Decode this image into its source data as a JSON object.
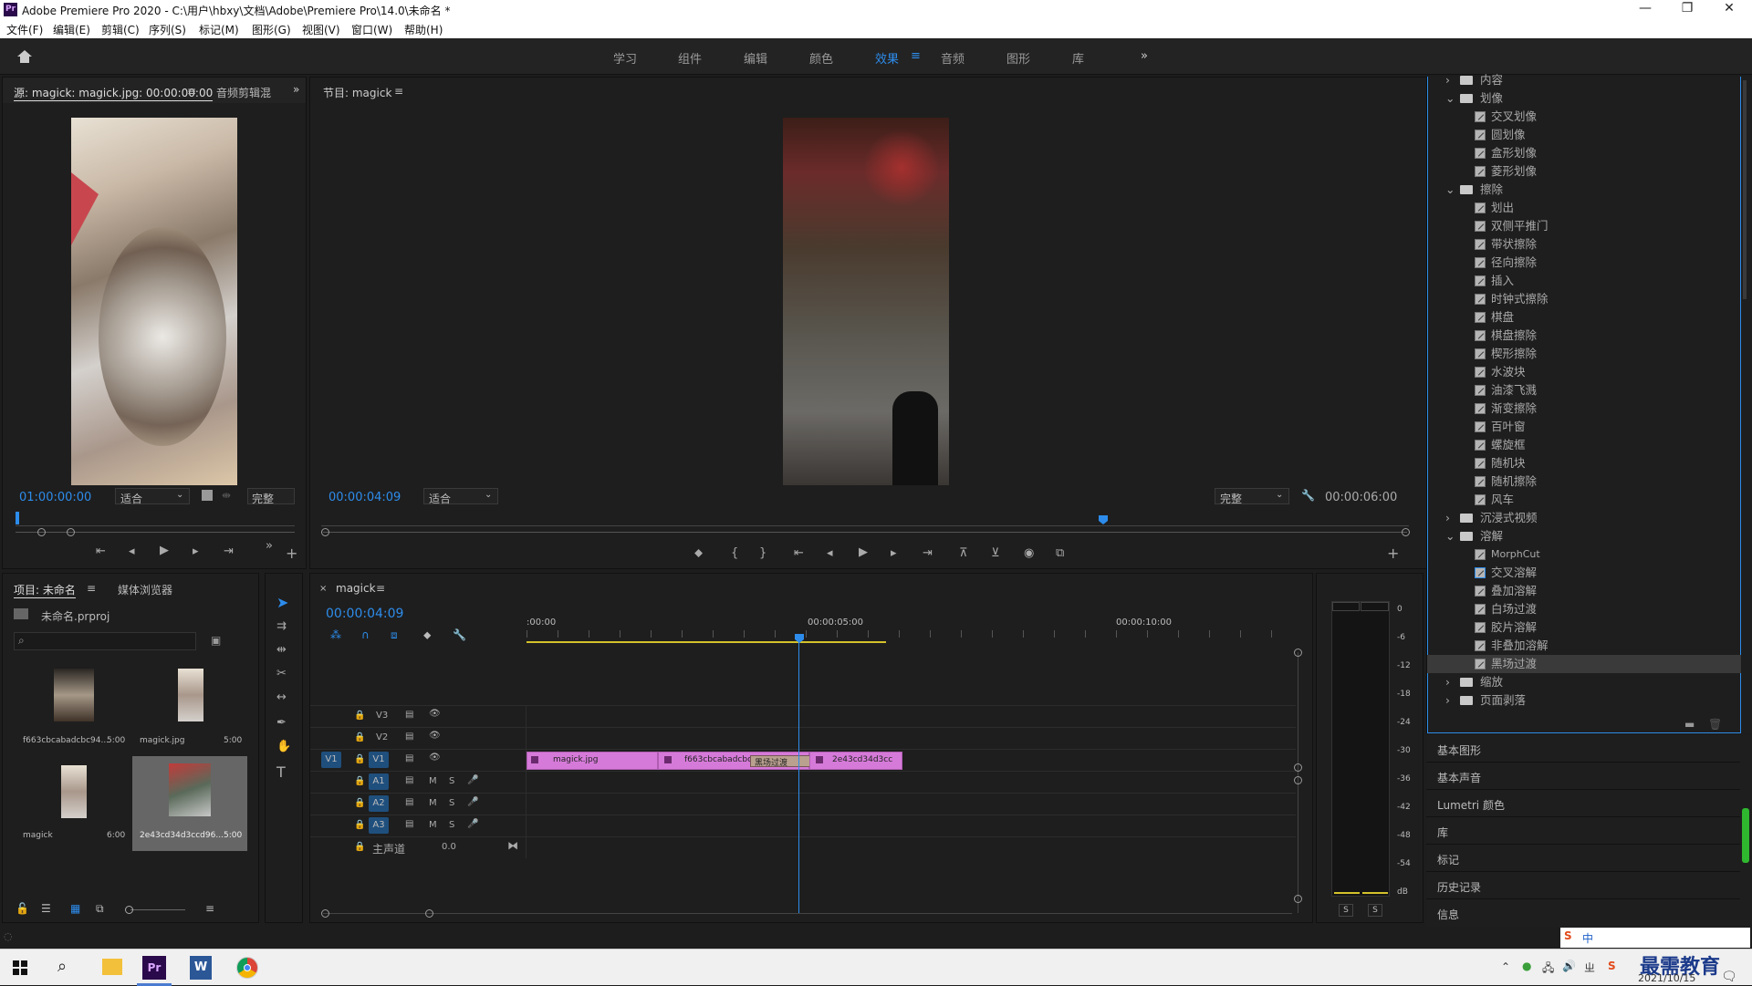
{
  "window": {
    "title": "Adobe Premiere Pro 2020 - C:\\用户\\hbxy\\文档\\Adobe\\Premiere Pro\\14.0\\未命名 *",
    "minimize": "—",
    "maximize": "❐",
    "close": "✕"
  },
  "menu": [
    "文件(F)",
    "编辑(E)",
    "剪辑(C)",
    "序列(S)",
    "标记(M)",
    "图形(G)",
    "视图(V)",
    "窗口(W)",
    "帮助(H)"
  ],
  "workspaces": [
    "学习",
    "组件",
    "编辑",
    "颜色",
    "效果",
    "音频",
    "图形",
    "库"
  ],
  "active_workspace": "效果",
  "source": {
    "tab": "源: magick: magick.jpg: 00:00:00:00",
    "tab2": "音频剪辑混",
    "timecode": "01:00:00:00",
    "fit": "适合",
    "quality": "完整"
  },
  "program": {
    "tab": "节目: magick",
    "timecode": "00:00:04:09",
    "fit": "适合",
    "quality": "完整",
    "duration": "00:00:06:00"
  },
  "project": {
    "tab": "项目: 未命名",
    "tab2": "媒体浏览器",
    "file": "未命名.prproj",
    "items": [
      {
        "name": "f663cbcabadcbc94...",
        "dur": "5:00"
      },
      {
        "name": "magick.jpg",
        "dur": "5:00"
      },
      {
        "name": "magick",
        "dur": "6:00"
      },
      {
        "name": "2e43cd34d3ccd96...",
        "dur": "5:00"
      }
    ]
  },
  "timeline": {
    "tab": "magick",
    "timecode": "00:00:04:09",
    "ruler": [
      ":00:00",
      "00:00:05:00",
      "00:00:10:00"
    ],
    "tracks": [
      "V3",
      "V2",
      "V1",
      "A1",
      "A2",
      "A3"
    ],
    "src_v1": "V1",
    "master": "主声道",
    "master_val": "0.0",
    "clips": [
      {
        "name": "magick.jpg"
      },
      {
        "name": "f663cbcabadcbc9"
      },
      {
        "name": "2e43cd34d3cc"
      }
    ],
    "transition": "黑场过渡",
    "m": "M",
    "s": "S"
  },
  "meter": {
    "scale": [
      "0",
      "-6",
      "-12",
      "-18",
      "-24",
      "-30",
      "-36",
      "-42",
      "-48",
      "-54",
      "dB"
    ],
    "s1": "S",
    "s2": "S"
  },
  "effects_tree": [
    {
      "type": "folder",
      "label": "内容",
      "open": false,
      "level": 0
    },
    {
      "type": "folder",
      "label": "划像",
      "open": true,
      "level": 0
    },
    {
      "type": "item",
      "label": "交叉划像"
    },
    {
      "type": "item",
      "label": "圆划像"
    },
    {
      "type": "item",
      "label": "盒形划像"
    },
    {
      "type": "item",
      "label": "菱形划像"
    },
    {
      "type": "folder",
      "label": "擦除",
      "open": true,
      "level": 0
    },
    {
      "type": "item",
      "label": "划出"
    },
    {
      "type": "item",
      "label": "双侧平推门"
    },
    {
      "type": "item",
      "label": "带状擦除"
    },
    {
      "type": "item",
      "label": "径向擦除"
    },
    {
      "type": "item",
      "label": "插入"
    },
    {
      "type": "item",
      "label": "时钟式擦除"
    },
    {
      "type": "item",
      "label": "棋盘"
    },
    {
      "type": "item",
      "label": "棋盘擦除"
    },
    {
      "type": "item",
      "label": "楔形擦除"
    },
    {
      "type": "item",
      "label": "水波块"
    },
    {
      "type": "item",
      "label": "油漆飞溅"
    },
    {
      "type": "item",
      "label": "渐变擦除"
    },
    {
      "type": "item",
      "label": "百叶窗"
    },
    {
      "type": "item",
      "label": "螺旋框"
    },
    {
      "type": "item",
      "label": "随机块"
    },
    {
      "type": "item",
      "label": "随机擦除"
    },
    {
      "type": "item",
      "label": "风车"
    },
    {
      "type": "folder",
      "label": "沉浸式视频",
      "open": false,
      "level": 0
    },
    {
      "type": "folder",
      "label": "溶解",
      "open": true,
      "level": 0
    },
    {
      "type": "item",
      "label": "MorphCut"
    },
    {
      "type": "item",
      "label": "交叉溶解",
      "hl": true
    },
    {
      "type": "item",
      "label": "叠加溶解"
    },
    {
      "type": "item",
      "label": "白场过渡"
    },
    {
      "type": "item",
      "label": "胶片溶解"
    },
    {
      "type": "item",
      "label": "非叠加溶解"
    },
    {
      "type": "item",
      "label": "黑场过渡",
      "sel": true
    },
    {
      "type": "folder",
      "label": "缩放",
      "open": false,
      "level": 0
    },
    {
      "type": "folder",
      "label": "页面剥落",
      "open": false,
      "level": 0
    }
  ],
  "side_panels": [
    "基本图形",
    "基本声音",
    "Lumetri 颜色",
    "库",
    "标记",
    "历史记录",
    "信息"
  ],
  "taskbar": {
    "date": "2021/10/15",
    "brand": "最需教育",
    "ime": "中"
  }
}
